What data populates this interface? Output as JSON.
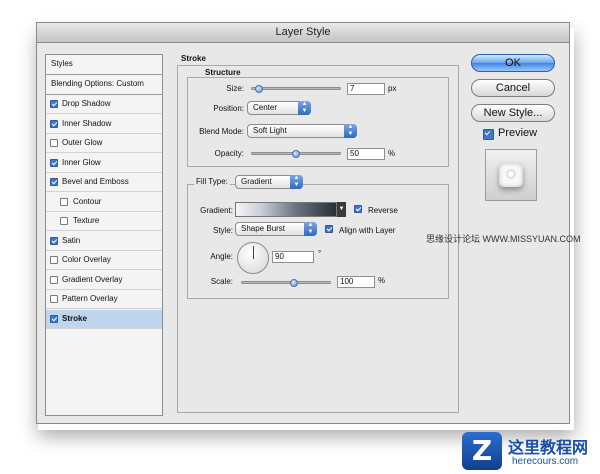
{
  "window": {
    "title": "Layer Style"
  },
  "styles_panel": {
    "header": "Styles",
    "blending_options": "Blending Options: Custom",
    "items": [
      {
        "label": "Drop Shadow",
        "checked": true,
        "indent": false,
        "selected": false
      },
      {
        "label": "Inner Shadow",
        "checked": true,
        "indent": false,
        "selected": false
      },
      {
        "label": "Outer Glow",
        "checked": false,
        "indent": false,
        "selected": false
      },
      {
        "label": "Inner Glow",
        "checked": true,
        "indent": false,
        "selected": false
      },
      {
        "label": "Bevel and Emboss",
        "checked": true,
        "indent": false,
        "selected": false
      },
      {
        "label": "Contour",
        "checked": false,
        "indent": true,
        "selected": false
      },
      {
        "label": "Texture",
        "checked": false,
        "indent": true,
        "selected": false
      },
      {
        "label": "Satin",
        "checked": true,
        "indent": false,
        "selected": false
      },
      {
        "label": "Color Overlay",
        "checked": false,
        "indent": false,
        "selected": false
      },
      {
        "label": "Gradient Overlay",
        "checked": false,
        "indent": false,
        "selected": false
      },
      {
        "label": "Pattern Overlay",
        "checked": false,
        "indent": false,
        "selected": false
      },
      {
        "label": "Stroke",
        "checked": true,
        "indent": false,
        "selected": true
      }
    ]
  },
  "stroke": {
    "section_title": "Stroke",
    "structure": {
      "title": "Structure",
      "size_label": "Size:",
      "size_value": "7",
      "size_unit": "px",
      "size_level": 0.05,
      "position_label": "Position:",
      "position_value": "Center",
      "blend_mode_label": "Blend Mode:",
      "blend_mode_value": "Soft Light",
      "opacity_label": "Opacity:",
      "opacity_value": "50",
      "opacity_unit": "%",
      "opacity_level": 0.5
    },
    "fill": {
      "fill_type_label": "Fill Type:",
      "fill_type_value": "Gradient",
      "gradient_label": "Gradient:",
      "reverse_label": "Reverse",
      "reverse_checked": true,
      "style_label": "Style:",
      "style_value": "Shape Burst",
      "align_label": "Align with Layer",
      "align_checked": true,
      "angle_label": "Angle:",
      "angle_value": "90",
      "angle_unit": "°",
      "scale_label": "Scale:",
      "scale_value": "100",
      "scale_unit": "%",
      "scale_level": 0.6
    }
  },
  "buttons": {
    "ok": "OK",
    "cancel": "Cancel",
    "new_style": "New Style...",
    "preview": "Preview",
    "preview_checked": true
  },
  "watermark": {
    "text": "思缘设计论坛 WWW.MISSYUAN.COM",
    "site_name": "这里教程网",
    "site_url": "herecours.com"
  },
  "colors": {
    "accent": "#3f79c6",
    "selected_row": "#bed4ef"
  }
}
